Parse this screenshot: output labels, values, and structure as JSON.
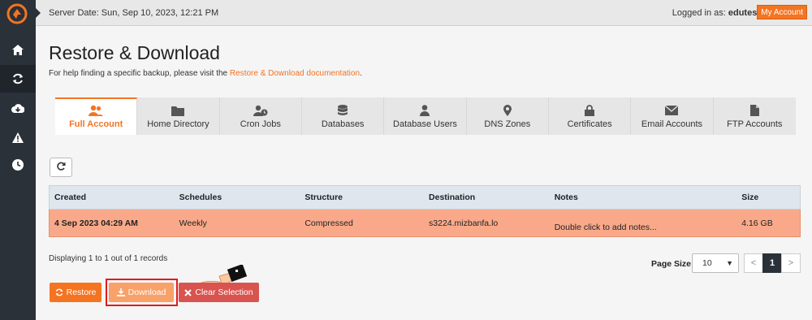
{
  "topbar": {
    "server_date": "Server Date: Sun, Sep 10, 2023, 12:21 PM",
    "logged_in_prefix": "Logged in as: ",
    "username": "edutest",
    "separator": "|",
    "my_account": "My Account"
  },
  "sidebar": {
    "items": [
      {
        "icon": "home-icon"
      },
      {
        "icon": "refresh-icon"
      },
      {
        "icon": "cloud-download-icon"
      },
      {
        "icon": "warning-icon"
      },
      {
        "icon": "clock-icon"
      }
    ]
  },
  "page": {
    "title": "Restore & Download",
    "help_text": "For help finding a specific backup, please visit the ",
    "help_link": "Restore & Download documentation",
    "help_end": "."
  },
  "tabs": [
    {
      "label": "Full Account",
      "icon": "users-icon",
      "active": true
    },
    {
      "label": "Home Directory",
      "icon": "folder-icon"
    },
    {
      "label": "Cron Jobs",
      "icon": "user-clock-icon"
    },
    {
      "label": "Databases",
      "icon": "database-icon"
    },
    {
      "label": "Database Users",
      "icon": "user-icon"
    },
    {
      "label": "DNS Zones",
      "icon": "map-marker-icon"
    },
    {
      "label": "Certificates",
      "icon": "lock-icon"
    },
    {
      "label": "Email Accounts",
      "icon": "envelope-icon"
    },
    {
      "label": "FTP Accounts",
      "icon": "file-icon"
    }
  ],
  "table": {
    "headers": [
      "Created",
      "Schedules",
      "Structure",
      "Destination",
      "Notes",
      "Size"
    ],
    "rows": [
      {
        "created": "4 Sep 2023 04:29 AM",
        "schedules": "Weekly",
        "structure": "Compressed",
        "destination": "s3224.mizbanfa.lo",
        "notes": "Double click to add notes...",
        "size": "4.16 GB"
      }
    ]
  },
  "footer": {
    "records": "Displaying 1 to 1 out of 1 records",
    "page_size_label": "Page Size",
    "page_size_value": "10",
    "pager": {
      "prev": "<",
      "current": "1",
      "next": ">"
    }
  },
  "actions": {
    "restore": "Restore",
    "download": "Download",
    "clear": "Clear Selection"
  },
  "colors": {
    "accent": "#f47422",
    "sidebar": "#2a3139",
    "selected_row": "#f9a98a",
    "danger": "#d9534f"
  }
}
